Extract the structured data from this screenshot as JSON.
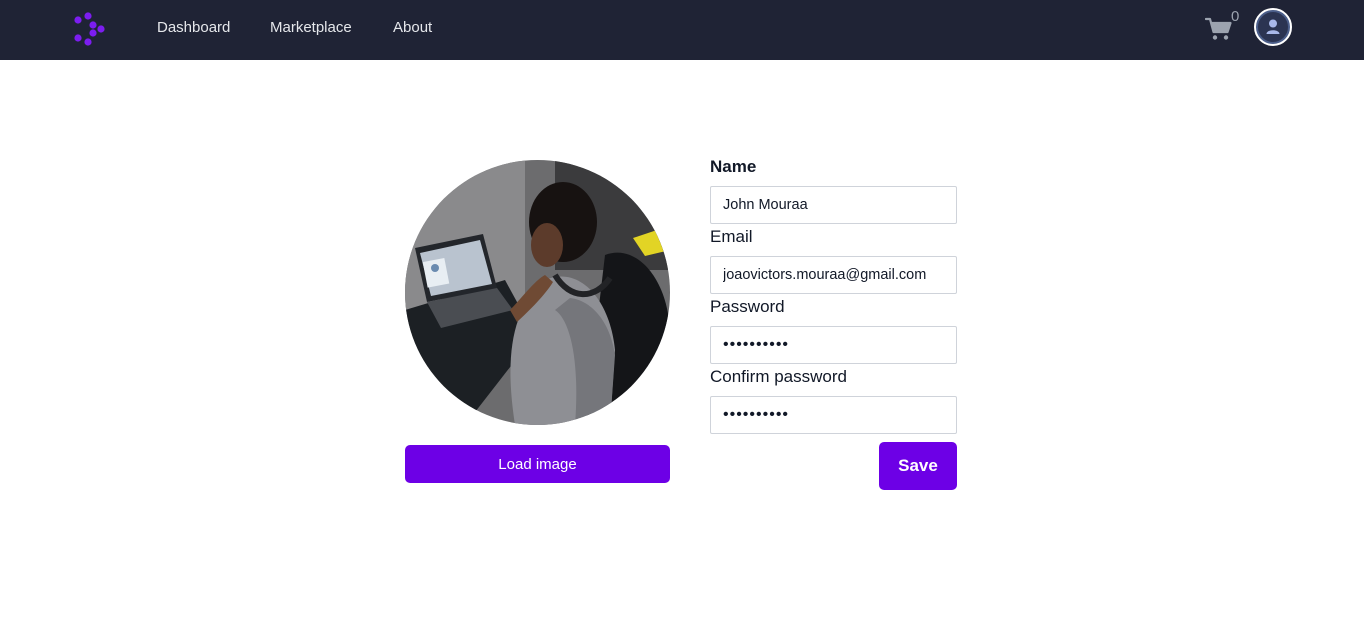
{
  "nav": {
    "logo_icon": "brand-dots-logo",
    "links": [
      {
        "label": "Dashboard"
      },
      {
        "label": "Marketplace"
      },
      {
        "label": "About"
      }
    ],
    "cart_icon": "cart-icon",
    "cart_count": "0",
    "user_icon": "user-avatar-icon"
  },
  "profile": {
    "photo_alt": "Profile photo",
    "load_image_label": "Load image"
  },
  "form": {
    "name_label": "Name",
    "name_value": "John Mouraa",
    "email_label": "Email",
    "email_value": "joaovictors.mouraa@gmail.com",
    "password_label": "Password",
    "password_value": "1234567890",
    "confirm_label": "Confirm password",
    "confirm_value": "1234567890",
    "save_label": "Save"
  },
  "colors": {
    "navbar_bg": "#1f2335",
    "accent": "#6d00e6",
    "logo": "#7c1df0"
  }
}
